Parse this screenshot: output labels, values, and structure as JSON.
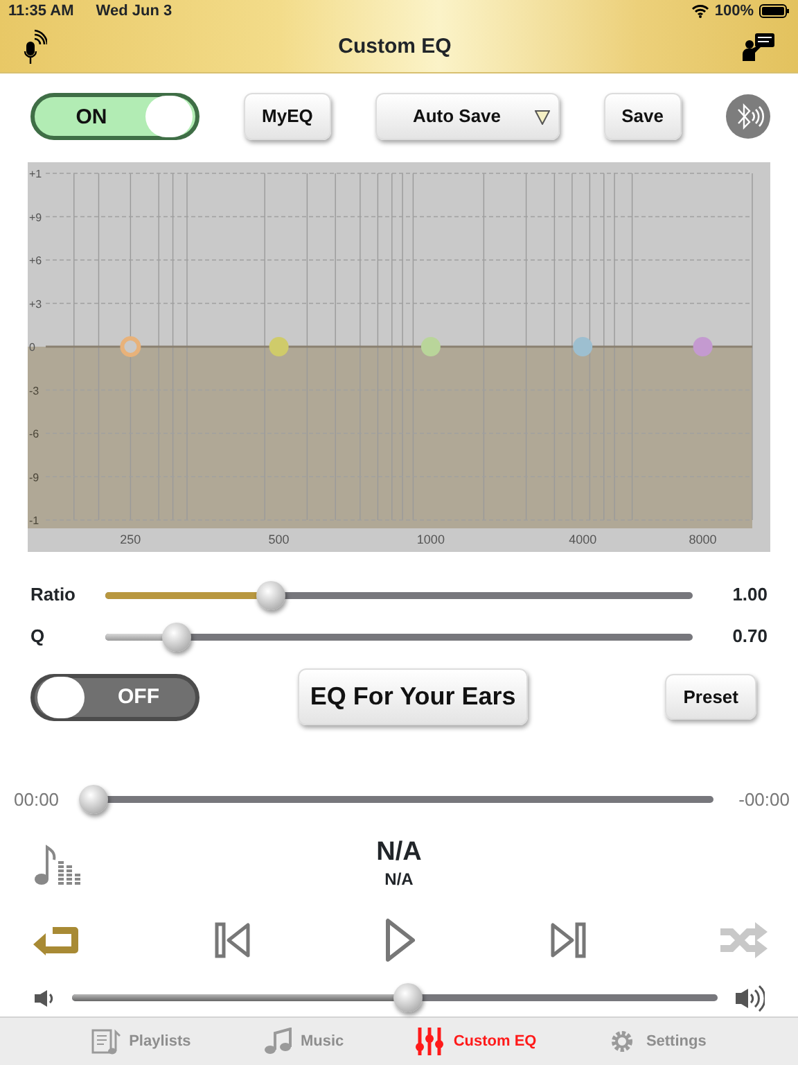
{
  "status_bar": {
    "time": "11:35 AM",
    "date": "Wed Jun 3",
    "battery": "100%"
  },
  "title": "Custom EQ",
  "eq_switch": {
    "label": "ON",
    "on": true
  },
  "buttons": [
    {
      "label": "MyEQ",
      "kind": "button"
    },
    {
      "label": "Auto Save",
      "kind": "dropdown"
    },
    {
      "label": "Save",
      "kind": "button"
    }
  ],
  "eq": {
    "y_labels": [
      "+1",
      "+9",
      "+6",
      "+3",
      "0",
      "-3",
      "-6",
      "-9",
      "-1"
    ],
    "x_labels": [
      "250",
      "500",
      "1000",
      "4000",
      "8000"
    ],
    "bands": [
      {
        "color": "#e8b27a",
        "selected": true
      },
      {
        "color": "#cfcb6a",
        "selected": false
      },
      {
        "color": "#b9d59a",
        "selected": false
      },
      {
        "color": "#9dbfd0",
        "selected": false
      },
      {
        "color": "#c49ad0",
        "selected": false
      }
    ]
  },
  "sliders": [
    {
      "label": "Ratio",
      "kind": "gold",
      "level": 0.28,
      "reading": "1.00"
    },
    {
      "label": "Q",
      "kind": "grey",
      "level": 0.12,
      "reading": "0.70"
    }
  ],
  "ears_switch": {
    "label": "OFF",
    "on": false
  },
  "ears_button": "EQ For Your Ears",
  "preset_button": "Preset",
  "progress": {
    "elapsed": "00:00",
    "remaining": "-00:00",
    "level": 0
  },
  "now_playing": {
    "title": "N/A",
    "artist": "N/A"
  },
  "repeat": {
    "on": true
  },
  "shuffle": {
    "on": false
  },
  "volume": {
    "level": 0.52
  },
  "tabs": [
    {
      "label": "Playlists",
      "selected": false
    },
    {
      "label": "Music",
      "selected": false
    },
    {
      "label": "Custom EQ",
      "selected": true
    },
    {
      "label": "Settings",
      "selected": false
    }
  ]
}
